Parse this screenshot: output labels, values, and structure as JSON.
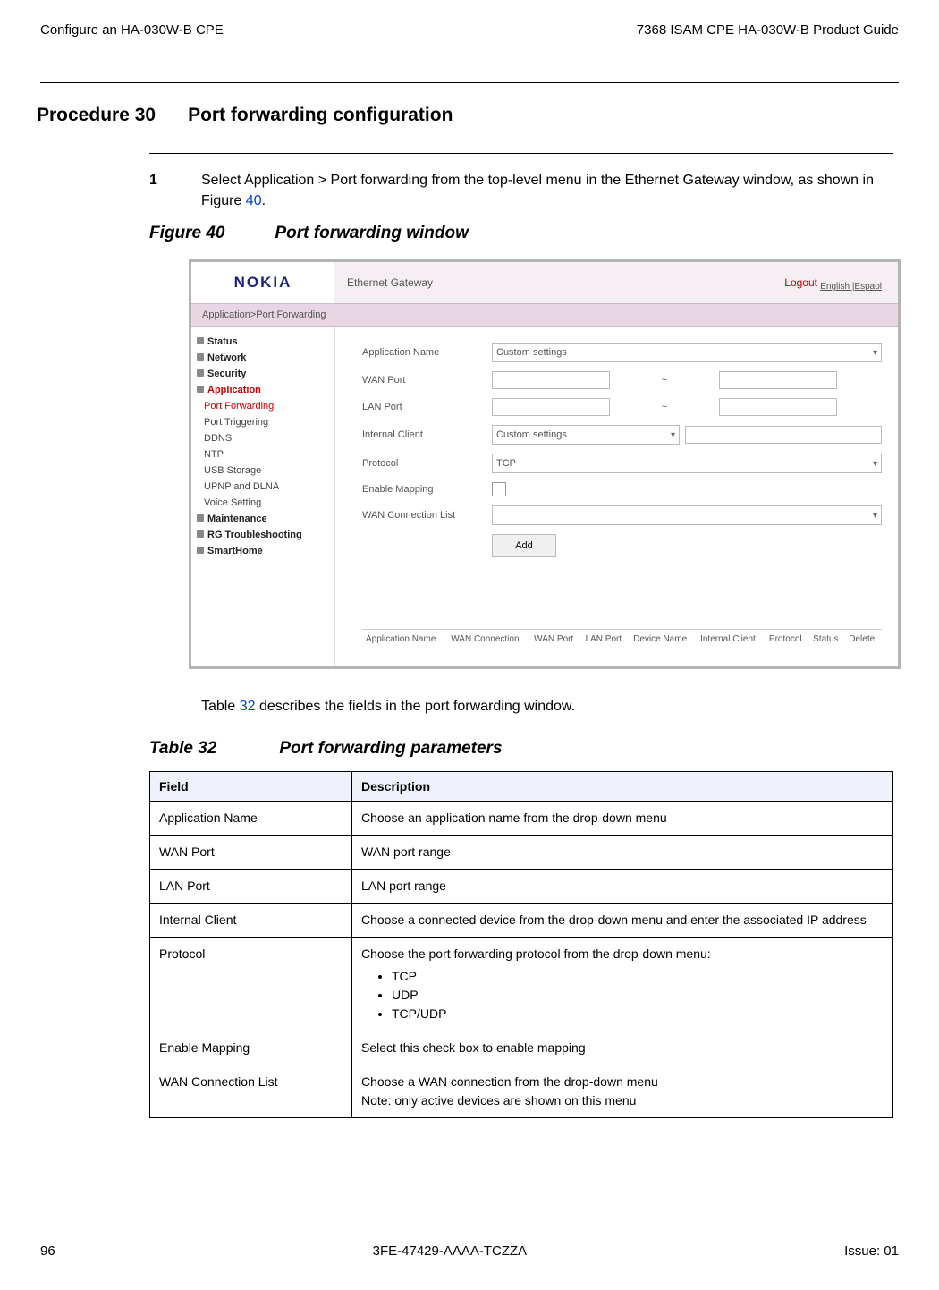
{
  "header": {
    "left": "Configure an HA-030W-B CPE",
    "right": "7368 ISAM CPE HA-030W-B Product Guide"
  },
  "procedure": {
    "label": "Procedure 30",
    "title": "Port forwarding configuration"
  },
  "step1": {
    "num": "1",
    "text_a": "Select Application > Port forwarding from the top-level menu in the Ethernet Gateway window, as shown in Figure ",
    "fig_ref": "40",
    "text_b": "."
  },
  "figure": {
    "label": "Figure 40",
    "title": "Port forwarding window"
  },
  "screenshot": {
    "logo": "NOKIA",
    "titlebar": "Ethernet Gateway",
    "logout": "Logout",
    "lang": "English |Espaol",
    "breadcrumb": "Application>Port Forwarding",
    "sidebar": {
      "status": "Status",
      "network": "Network",
      "security": "Security",
      "application": "Application",
      "pf": "Port Forwarding",
      "pt": "Port Triggering",
      "ddns": "DDNS",
      "ntp": "NTP",
      "usb": "USB Storage",
      "upnp": "UPNP and DLNA",
      "voice": "Voice Setting",
      "maint": "Maintenance",
      "rg": "RG Troubleshooting",
      "smart": "SmartHome"
    },
    "form": {
      "appname_label": "Application Name",
      "appname_value": "Custom settings",
      "wanport_label": "WAN Port",
      "lanport_label": "LAN Port",
      "tilde": "~",
      "ic_label": "Internal Client",
      "ic_value": "Custom settings",
      "proto_label": "Protocol",
      "proto_value": "TCP",
      "enable_label": "Enable Mapping",
      "wcl_label": "WAN Connection List",
      "add": "Add"
    },
    "table_headers": {
      "c1": "Application Name",
      "c2": "WAN Connection",
      "c3": "WAN Port",
      "c4": "LAN Port",
      "c5": "Device Name",
      "c6": "Internal Client",
      "c7": "Protocol",
      "c8": "Status",
      "c9": "Delete"
    }
  },
  "para_table_intro_a": "Table ",
  "para_table_ref": "32",
  "para_table_intro_b": " describes the fields in the port forwarding window.",
  "table_caption": {
    "label": "Table 32",
    "title": "Port forwarding parameters"
  },
  "params": {
    "head_field": "Field",
    "head_desc": "Description",
    "rows": [
      {
        "field": "Application Name",
        "desc": "Choose an application name from the drop-down menu"
      },
      {
        "field": "WAN Port",
        "desc": "WAN port range"
      },
      {
        "field": "LAN Port",
        "desc": "LAN port range"
      },
      {
        "field": "Internal Client",
        "desc": "Choose a connected device from the drop-down menu and enter the associated IP address"
      },
      {
        "field": "Protocol",
        "desc_intro": "Choose the port forwarding protocol from the drop-down menu:",
        "opts": [
          "TCP",
          "UDP",
          "TCP/UDP"
        ]
      },
      {
        "field": "Enable Mapping",
        "desc": "Select this check box to enable mapping"
      },
      {
        "field": "WAN Connection List",
        "desc_line1": "Choose a WAN connection from the drop-down menu",
        "desc_line2": "Note: only active devices are shown on this menu"
      }
    ]
  },
  "footer": {
    "page": "96",
    "doc": "3FE-47429-AAAA-TCZZA",
    "issue": "Issue: 01"
  }
}
